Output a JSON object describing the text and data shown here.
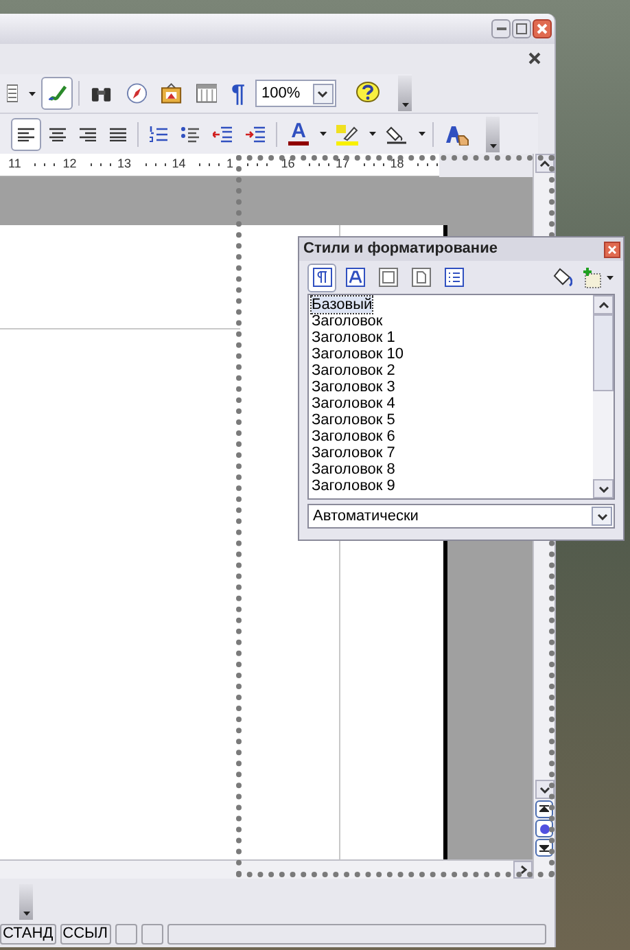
{
  "toolbar_1": [
    {
      "kind": "list",
      "pressed": false
    },
    {
      "kind": "dropdown",
      "pressed": false
    },
    {
      "kind": "pen",
      "pressed": true
    },
    {
      "kind": "binoculars",
      "pressed": false
    },
    {
      "kind": "compass",
      "pressed": false
    },
    {
      "kind": "gallery",
      "pressed": false
    },
    {
      "kind": "table",
      "pressed": false
    },
    {
      "kind": "pilcrow",
      "label": "¶",
      "pressed": false
    }
  ],
  "zoom": {
    "value": "100%"
  },
  "toolbar_2": [
    {
      "kind": "align-left",
      "pressed": true
    },
    {
      "kind": "align-center",
      "pressed": false
    },
    {
      "kind": "align-right",
      "pressed": false
    },
    {
      "kind": "justify",
      "pressed": false
    },
    {
      "kind": "numbering",
      "pressed": false
    },
    {
      "kind": "bullets",
      "pressed": false
    },
    {
      "kind": "outdent",
      "pressed": false
    },
    {
      "kind": "indent",
      "pressed": false
    },
    {
      "kind": "font-color",
      "label": "A",
      "pressed": false
    },
    {
      "kind": "highlight",
      "pressed": false
    },
    {
      "kind": "background",
      "pressed": false
    },
    {
      "kind": "styles",
      "pressed": false
    }
  ],
  "ruler": [
    "11",
    "12",
    "13",
    "14",
    "1",
    "16",
    "17",
    "18"
  ],
  "styles_panel": {
    "title": "Стили и форматирование",
    "categories": [
      {
        "kind": "paragraph",
        "selected": true
      },
      {
        "kind": "character",
        "selected": false
      },
      {
        "kind": "frame",
        "selected": false
      },
      {
        "kind": "page",
        "selected": false
      },
      {
        "kind": "list",
        "selected": false
      }
    ],
    "styles": [
      {
        "name": "Базовый",
        "selected": true
      },
      {
        "name": "Заголовок",
        "selected": false
      },
      {
        "name": "Заголовок 1",
        "selected": false
      },
      {
        "name": "Заголовок 10",
        "selected": false
      },
      {
        "name": "Заголовок 2",
        "selected": false
      },
      {
        "name": "Заголовок 3",
        "selected": false
      },
      {
        "name": "Заголовок 4",
        "selected": false
      },
      {
        "name": "Заголовок 5",
        "selected": false
      },
      {
        "name": "Заголовок 6",
        "selected": false
      },
      {
        "name": "Заголовок 7",
        "selected": false
      },
      {
        "name": "Заголовок 8",
        "selected": false
      },
      {
        "name": "Заголовок 9",
        "selected": false
      }
    ],
    "filter": "Автоматически"
  },
  "status_bar": [
    "СТАНД",
    "ССЫЛ"
  ]
}
